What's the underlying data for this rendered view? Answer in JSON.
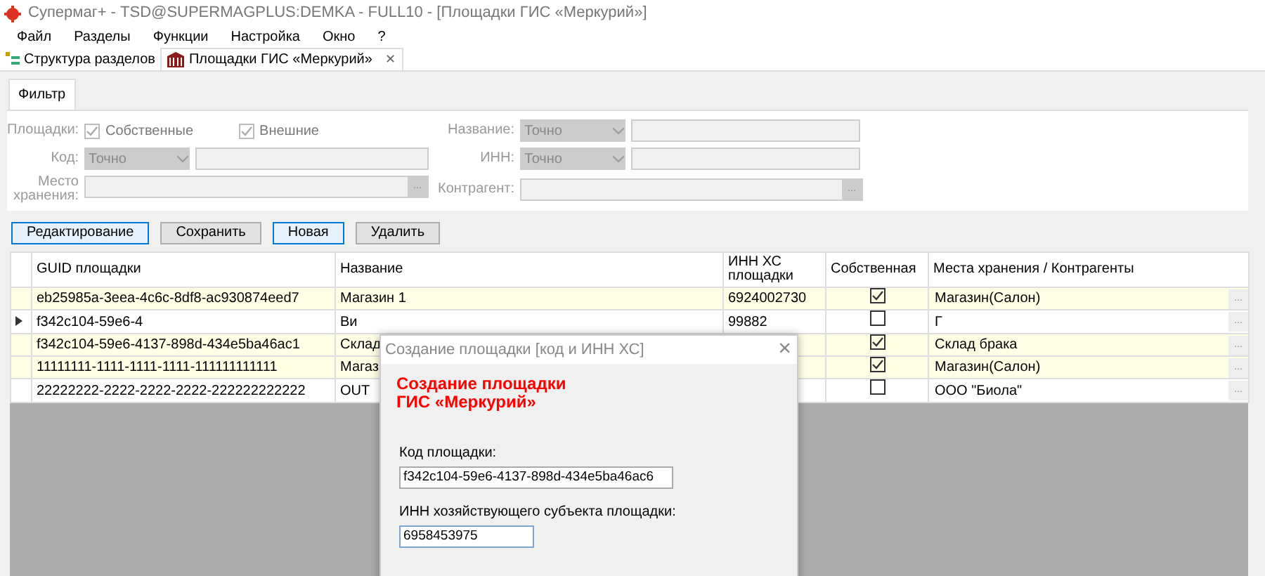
{
  "window": {
    "title": "Супермаг+ - TSD@SUPERMAGPLUS:DEMKA - FULL10  - [Площадки ГИС «Меркурий»]"
  },
  "menu": [
    "Файл",
    "Разделы",
    "Функции",
    "Настройка",
    "Окно",
    "?"
  ],
  "tabs": [
    {
      "label": "Структура разделов",
      "selected": false
    },
    {
      "label": "Площадки ГИС «Меркурий»",
      "selected": true,
      "close": "✕"
    }
  ],
  "filter": {
    "tab": "Фильтр",
    "sites_label": "Площадки:",
    "checks": [
      {
        "label": "Собственные",
        "checked": true
      },
      {
        "label": "Внешние",
        "checked": true
      }
    ],
    "code": {
      "label": "Код:",
      "mode": "Точно"
    },
    "storage_label": [
      "Место",
      "хранения:"
    ],
    "name": {
      "label": "Название:",
      "mode": "Точно"
    },
    "inn": {
      "label": "ИНН:",
      "mode": "Точно"
    },
    "counterparty_label": "Контрагент:",
    "browse": "..."
  },
  "buttons": [
    {
      "label": "Редактирование",
      "selected": true
    },
    {
      "label": "Сохранить",
      "selected": false
    },
    {
      "label": "Новая",
      "selected": true
    },
    {
      "label": "Удалить",
      "selected": false
    }
  ],
  "table": {
    "columns": [
      "GUID площадки",
      "Название",
      "ИНН ХС площадки",
      "Собственная",
      "Места хранения / Контрагенты"
    ],
    "rows": [
      {
        "guid": "eb25985a-3eea-4c6c-8df8-ac930874eed7",
        "name": "Магазин 1",
        "inn": "6924002730",
        "own": true,
        "place": "Магазин(Салон)",
        "current": false
      },
      {
        "guid": "f342c104-59e6-4",
        "name": "Ви",
        "inn": "99882",
        "own": false,
        "place": "Г",
        "current": true
      },
      {
        "guid": "f342c104-59e6-4137-898d-434e5ba46ac1",
        "name": "Склад",
        "own": true,
        "place": "Склад брака",
        "current": false
      },
      {
        "guid": "11111111-1111-1111-1111-111111111111",
        "name": "Магаз",
        "own": true,
        "place": "Магазин(Салон)",
        "current": false
      },
      {
        "guid": "22222222-2222-2222-2222-222222222222",
        "name": "OUT",
        "own": false,
        "place": "ООО \"Биола\"",
        "current": false
      }
    ],
    "browse": "..."
  },
  "dialog": {
    "title": "Создание площадки [код и ИНН ХС]",
    "close": "×",
    "heading": [
      "Создание площадки",
      "ГИС «Меркурий»"
    ],
    "fields": [
      {
        "label": "Код площадки:",
        "value": "f342c104-59e6-4137-898d-434e5ba46ac6",
        "focused": false
      },
      {
        "label": "ИНН хозяйствующего субъекта площадки:",
        "value": "6958453975",
        "focused": true
      }
    ]
  }
}
